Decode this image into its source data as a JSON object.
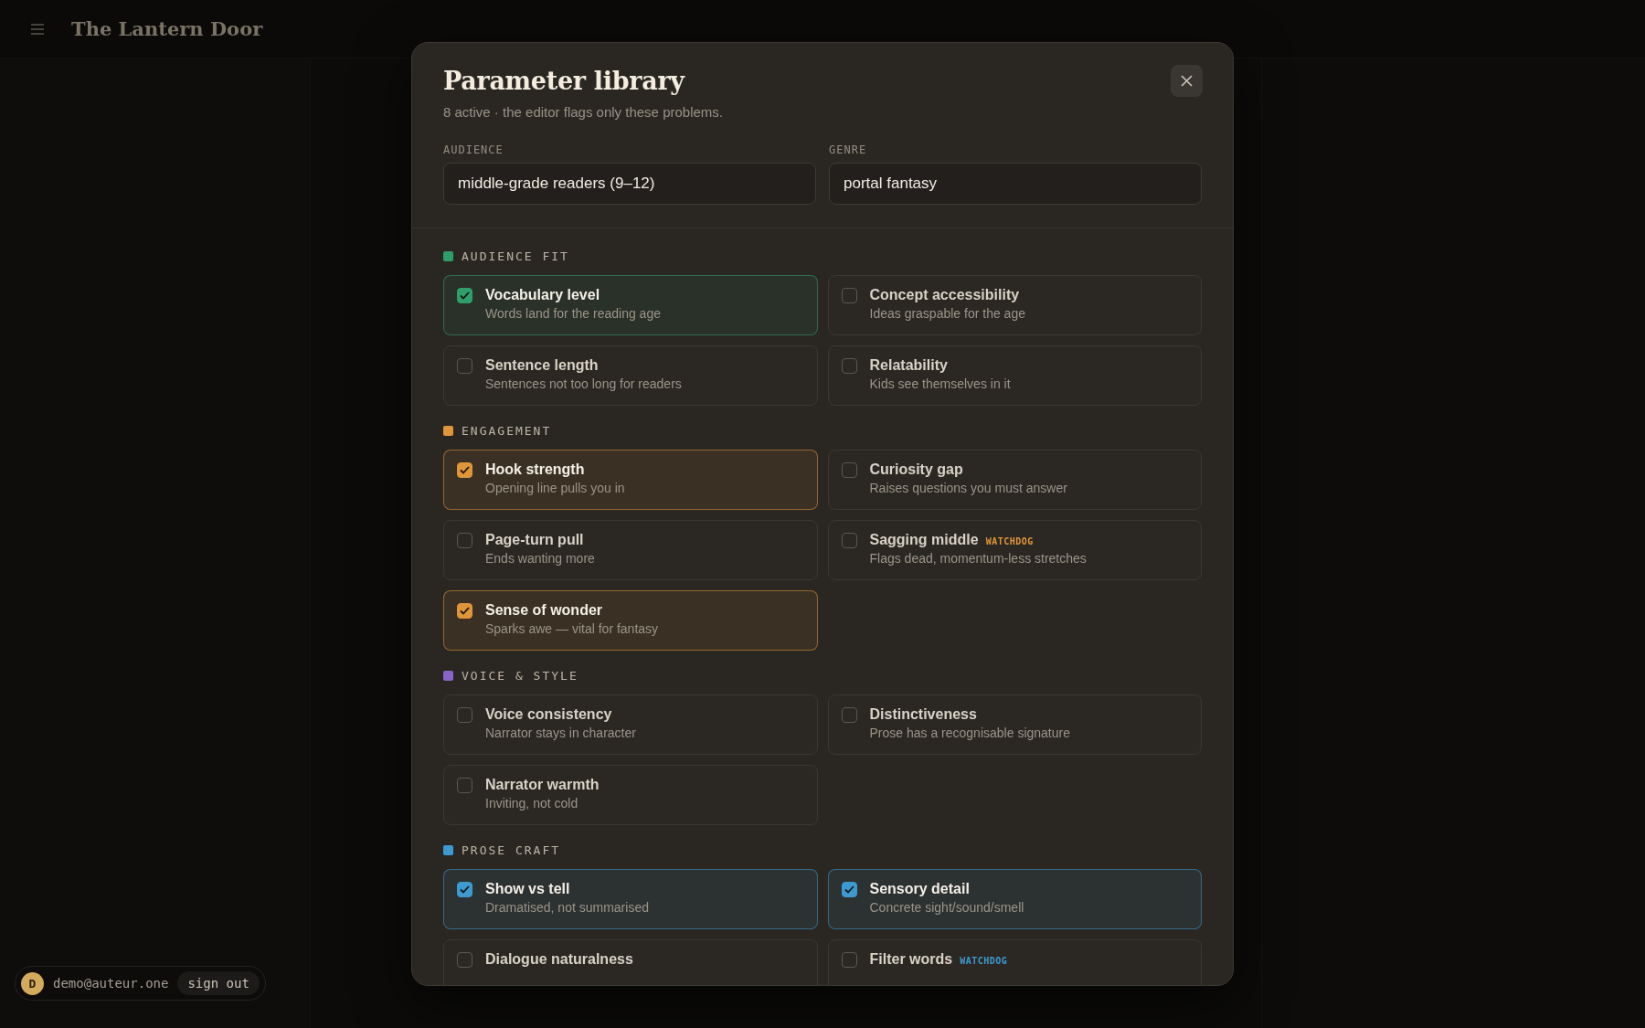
{
  "app": {
    "title": "The Lantern Door"
  },
  "modal": {
    "title": "Parameter library",
    "subtitle": "8 active · the editor flags only these problems.",
    "fields": [
      {
        "label": "AUDIENCE",
        "value": "middle-grade readers (9–12)"
      },
      {
        "label": "GENRE",
        "value": "portal fantasy"
      }
    ],
    "sections": [
      {
        "name": "AUDIENCE FIT",
        "color": "#2e9e6a",
        "items": [
          {
            "title": "Vocabulary level",
            "description": "Words land for the reading age",
            "checked": true
          },
          {
            "title": "Concept accessibility",
            "description": "Ideas graspable for the age",
            "checked": false
          },
          {
            "title": "Sentence length",
            "description": "Sentences not too long for readers",
            "checked": false
          },
          {
            "title": "Relatability",
            "description": "Kids see themselves in it",
            "checked": false
          }
        ]
      },
      {
        "name": "ENGAGEMENT",
        "color": "#e0953a",
        "items": [
          {
            "title": "Hook strength",
            "description": "Opening line pulls you in",
            "checked": true
          },
          {
            "title": "Curiosity gap",
            "description": "Raises questions you must answer",
            "checked": false
          },
          {
            "title": "Page-turn pull",
            "description": "Ends wanting more",
            "checked": false
          },
          {
            "title": "Sagging middle",
            "tag": "WATCHDOG",
            "description": "Flags dead, momentum-less stretches",
            "checked": false
          },
          {
            "title": "Sense of wonder",
            "description": "Sparks awe — vital for fantasy",
            "checked": true
          }
        ]
      },
      {
        "name": "VOICE & STYLE",
        "color": "#8a65c9",
        "items": [
          {
            "title": "Voice consistency",
            "description": "Narrator stays in character",
            "checked": false
          },
          {
            "title": "Distinctiveness",
            "description": "Prose has a recognisable signature",
            "checked": false
          },
          {
            "title": "Narrator warmth",
            "description": "Inviting, not cold",
            "checked": false
          }
        ]
      },
      {
        "name": "PROSE CRAFT",
        "color": "#3d9ad1",
        "items": [
          {
            "title": "Show vs tell",
            "description": "Dramatised, not summarised",
            "checked": true
          },
          {
            "title": "Sensory detail",
            "description": "Concrete sight/sound/smell",
            "checked": true
          },
          {
            "title": "Dialogue naturalness",
            "checked": false
          },
          {
            "title": "Filter words",
            "tag": "WATCHDOG",
            "checked": false
          }
        ]
      }
    ]
  },
  "user": {
    "initial": "D",
    "email": "demo@auteur.one",
    "sign_out": "sign out"
  }
}
